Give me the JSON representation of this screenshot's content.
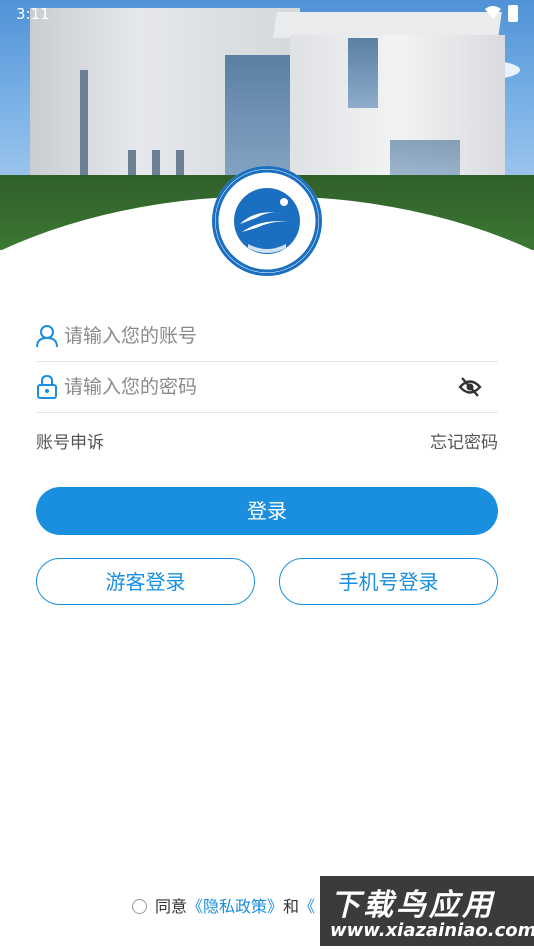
{
  "status_bar": {
    "time": "3:11"
  },
  "login": {
    "account_placeholder": "请输入您的账号",
    "password_placeholder": "请输入您的密码",
    "account_appeal": "账号申诉",
    "forgot_password": "忘记密码",
    "login_button": "登录",
    "guest_login": "游客登录",
    "phone_login": "手机号登录"
  },
  "agreement": {
    "prefix": "同意",
    "privacy_policy": "《隐私政策》",
    "and": "和",
    "second_doc": "《"
  },
  "watermark": {
    "title": "下载鸟应用",
    "url": "www.xiazainiao.com"
  },
  "colors": {
    "accent": "#1a8fe0"
  },
  "icons": [
    "user-icon",
    "lock-icon",
    "eye-off-icon",
    "wifi-icon",
    "battery-icon",
    "college-logo"
  ]
}
